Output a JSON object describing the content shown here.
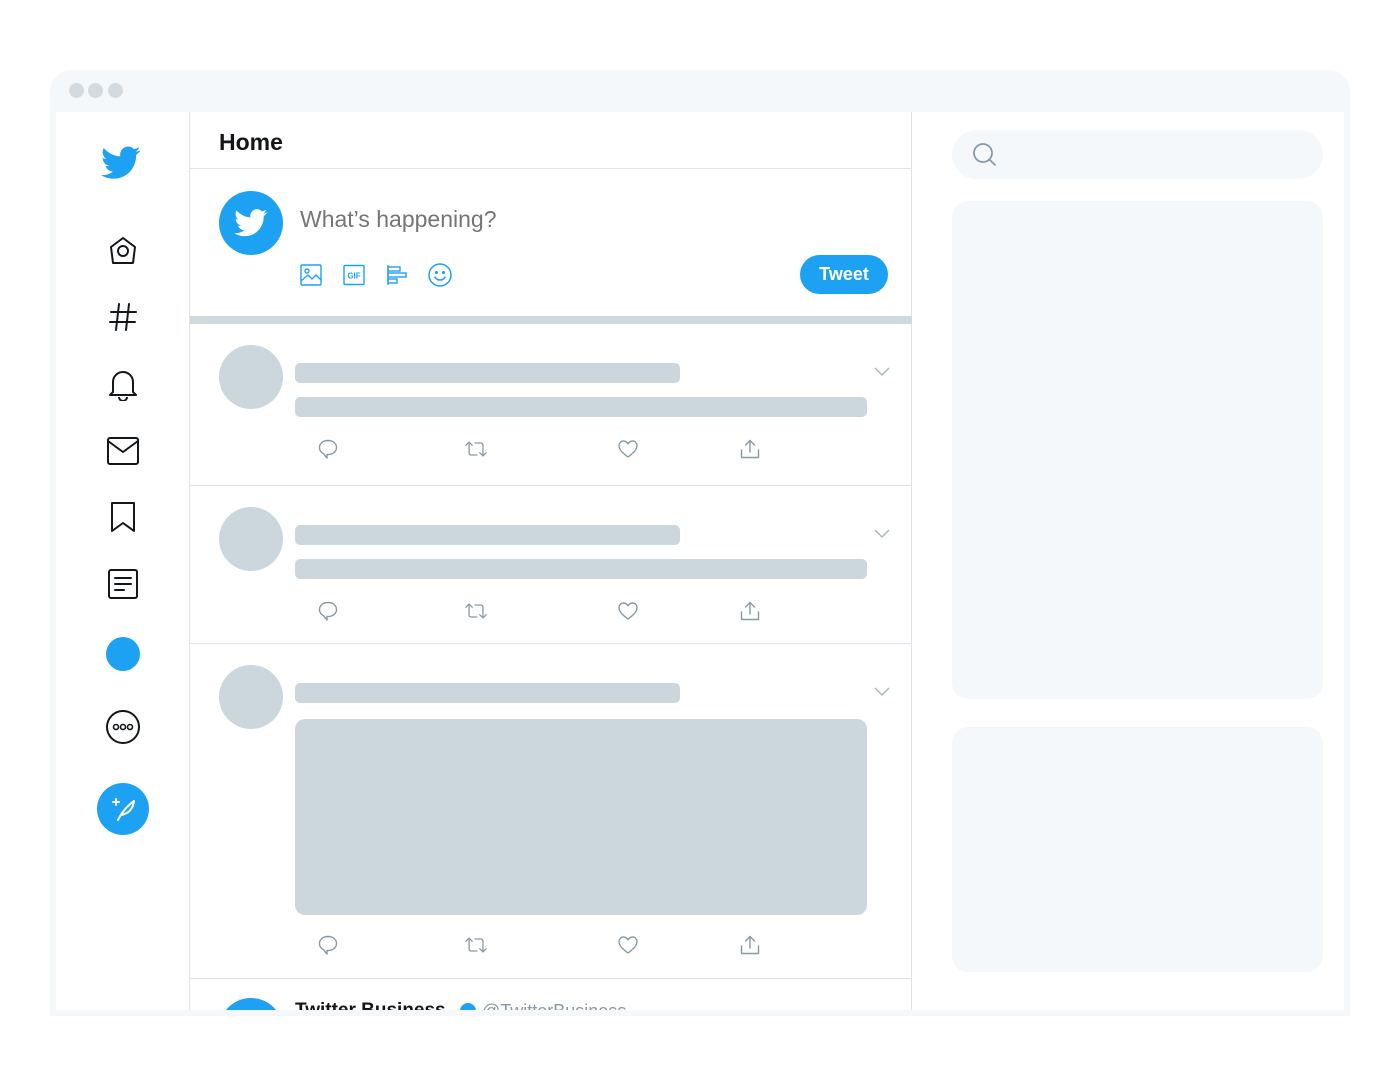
{
  "window": {
    "buttons": [
      "close",
      "minimize",
      "maximize"
    ]
  },
  "nav": {
    "items": [
      {
        "icon": "twitter-bird-icon",
        "label": "Twitter"
      },
      {
        "icon": "home-icon",
        "label": "Home"
      },
      {
        "icon": "hashtag-icon",
        "label": "Explore"
      },
      {
        "icon": "bell-icon",
        "label": "Notifications"
      },
      {
        "icon": "mail-icon",
        "label": "Messages"
      },
      {
        "icon": "bookmark-icon",
        "label": "Bookmarks"
      },
      {
        "icon": "list-icon",
        "label": "Lists"
      },
      {
        "icon": "profile-avatar-icon",
        "label": "Profile"
      },
      {
        "icon": "more-icon",
        "label": "More"
      },
      {
        "icon": "compose-feather-icon",
        "label": "Tweet"
      }
    ]
  },
  "header": {
    "title": "Home"
  },
  "composer": {
    "placeholder": "What’s happening?",
    "tools": [
      "image-icon",
      "gif-icon",
      "poll-icon",
      "emoji-icon"
    ],
    "gif_label": "GIF",
    "tweet_button": "Tweet"
  },
  "timeline": {
    "actions": [
      "reply-icon",
      "retweet-icon",
      "like-icon",
      "share-icon"
    ],
    "peek_tweet": {
      "name": "Twitter Business",
      "handle": "@TwitterBusiness"
    }
  },
  "search": {
    "placeholder": ""
  },
  "colors": {
    "accent": "#1da1f2",
    "skeleton": "#ccd6dd",
    "background_light": "#f5f8fa",
    "border": "#dde3e8",
    "icon_dark": "#14171a",
    "icon_gray": "#8899a6"
  }
}
